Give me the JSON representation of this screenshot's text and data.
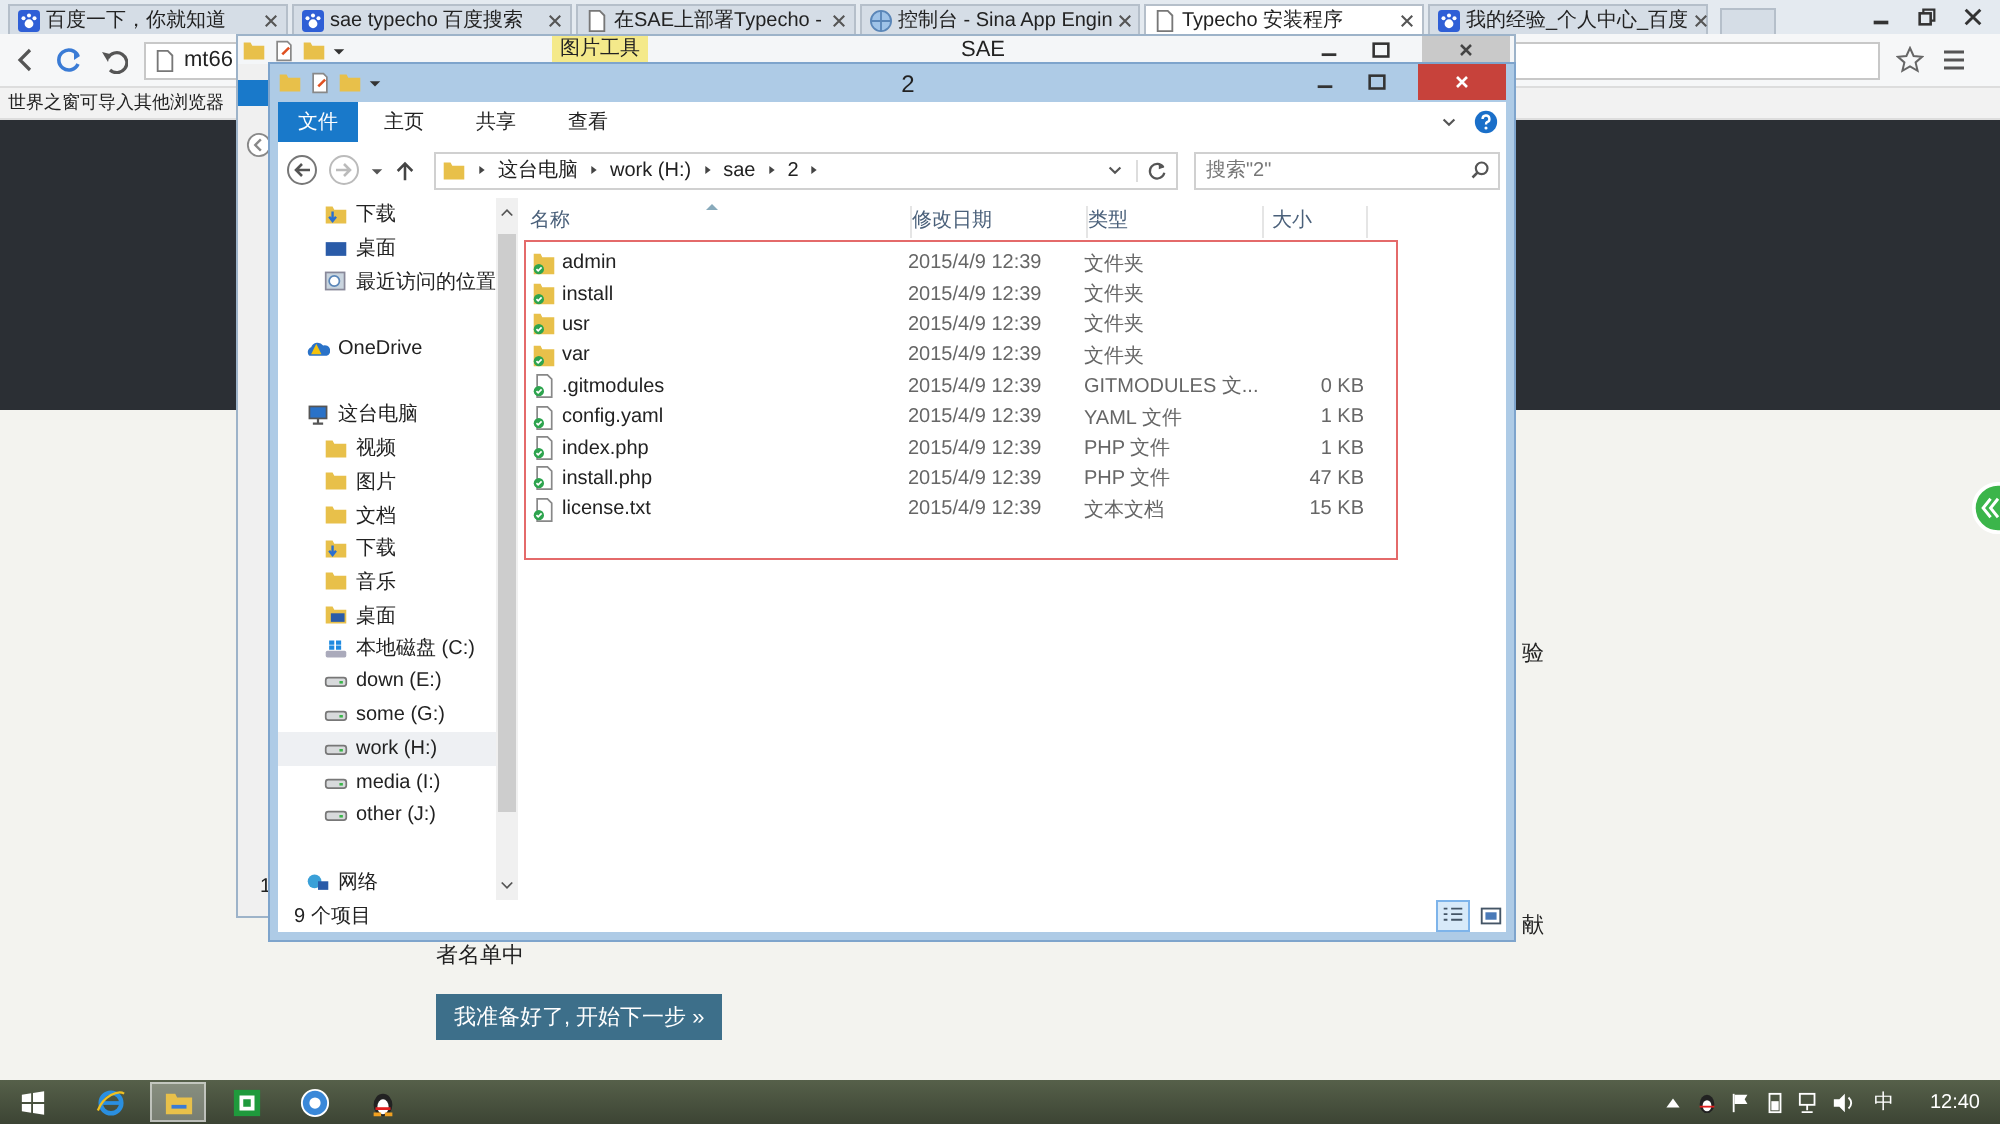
{
  "browser": {
    "tabs": [
      {
        "title": "百度一下，你就知道",
        "kind": "paw",
        "selected": false
      },
      {
        "title": "sae typecho 百度搜索",
        "kind": "paw",
        "selected": false
      },
      {
        "title": "在SAE上部署Typecho -",
        "kind": "page",
        "selected": false
      },
      {
        "title": "控制台 - Sina App Engin",
        "kind": "globe",
        "selected": false
      },
      {
        "title": "Typecho 安装程序",
        "kind": "page",
        "selected": true
      },
      {
        "title": "我的经验_个人中心_百度",
        "kind": "paw",
        "selected": false
      }
    ],
    "address": "mt66",
    "bookmark_bar": "世界之窗可导入其他浏览器"
  },
  "page": {
    "line_1_end": "验",
    "line_2_end": "献",
    "line_3": "者名单中",
    "next_button": "我准备好了, 开始下一步 »"
  },
  "back_window": {
    "title": "SAE",
    "context_tab": "图片工具",
    "status_fragment": "1"
  },
  "explorer": {
    "title": "2",
    "ribbon_tabs": [
      {
        "label": "文件",
        "kind": "file-menu"
      },
      {
        "label": "主页",
        "kind": "tab"
      },
      {
        "label": "共享",
        "kind": "tab"
      },
      {
        "label": "查看",
        "kind": "tab"
      }
    ],
    "breadcrumb": [
      "这台电脑",
      "work (H:)",
      "sae",
      "2"
    ],
    "search": {
      "placeholder": "搜索\"2\""
    },
    "nav_favorites": [
      {
        "label": "下载",
        "kind": "download",
        "selected": false
      },
      {
        "label": "桌面",
        "kind": "desktop",
        "selected": false
      },
      {
        "label": "最近访问的位置",
        "kind": "recent",
        "selected": false
      }
    ],
    "nav_tree": [
      {
        "label": "OneDrive",
        "kind": "cloud",
        "selected": false
      },
      {
        "label": "这台电脑",
        "kind": "pc",
        "selected": false,
        "children": [
          {
            "label": "视频",
            "kind": "folder",
            "selected": false
          },
          {
            "label": "图片",
            "kind": "folder",
            "selected": false
          },
          {
            "label": "文档",
            "kind": "folder",
            "selected": false
          },
          {
            "label": "下载",
            "kind": "download",
            "selected": false
          },
          {
            "label": "音乐",
            "kind": "folder",
            "selected": false
          },
          {
            "label": "桌面",
            "kind": "desktop",
            "selected": false
          },
          {
            "label": "本地磁盘 (C:)",
            "kind": "system-drive",
            "selected": false
          },
          {
            "label": "down (E:)",
            "kind": "drive",
            "selected": false
          },
          {
            "label": "some (G:)",
            "kind": "drive",
            "selected": false
          },
          {
            "label": "work (H:)",
            "kind": "drive",
            "selected": true
          },
          {
            "label": "media (I:)",
            "kind": "drive",
            "selected": false
          },
          {
            "label": "other (J:)",
            "kind": "drive",
            "selected": false
          }
        ]
      },
      {
        "label": "网络",
        "kind": "network",
        "selected": false
      }
    ],
    "columns": [
      "名称",
      "修改日期",
      "类型",
      "大小"
    ],
    "files": [
      {
        "name": "admin",
        "date": "2015/4/9 12:39",
        "type": "文件夹",
        "kind": "folder"
      },
      {
        "name": "install",
        "date": "2015/4/9 12:39",
        "type": "文件夹",
        "kind": "folder"
      },
      {
        "name": "usr",
        "date": "2015/4/9 12:39",
        "type": "文件夹",
        "kind": "folder"
      },
      {
        "name": "var",
        "date": "2015/4/9 12:39",
        "type": "文件夹",
        "kind": "folder"
      },
      {
        "name": ".gitmodules",
        "date": "2015/4/9 12:39",
        "type": "GITMODULES 文...",
        "size": "0 KB",
        "kind": "file"
      },
      {
        "name": "config.yaml",
        "date": "2015/4/9 12:39",
        "type": "YAML 文件",
        "size": "1 KB",
        "kind": "file"
      },
      {
        "name": "index.php",
        "date": "2015/4/9 12:39",
        "type": "PHP 文件",
        "size": "1 KB",
        "kind": "file"
      },
      {
        "name": "install.php",
        "date": "2015/4/9 12:39",
        "type": "PHP 文件",
        "size": "47 KB",
        "kind": "file"
      },
      {
        "name": "license.txt",
        "date": "2015/4/9 12:39",
        "type": "文本文档",
        "size": "15 KB",
        "kind": "file"
      }
    ],
    "status": "9 个项目"
  },
  "taskbar": {
    "apps": [
      {
        "kind": "ie",
        "selected": false
      },
      {
        "kind": "explorer",
        "selected": true
      },
      {
        "kind": "spreadsheet",
        "selected": false
      },
      {
        "kind": "browser",
        "selected": false
      },
      {
        "kind": "penguin",
        "selected": false
      }
    ],
    "ime": "中",
    "clock": "12:40"
  }
}
